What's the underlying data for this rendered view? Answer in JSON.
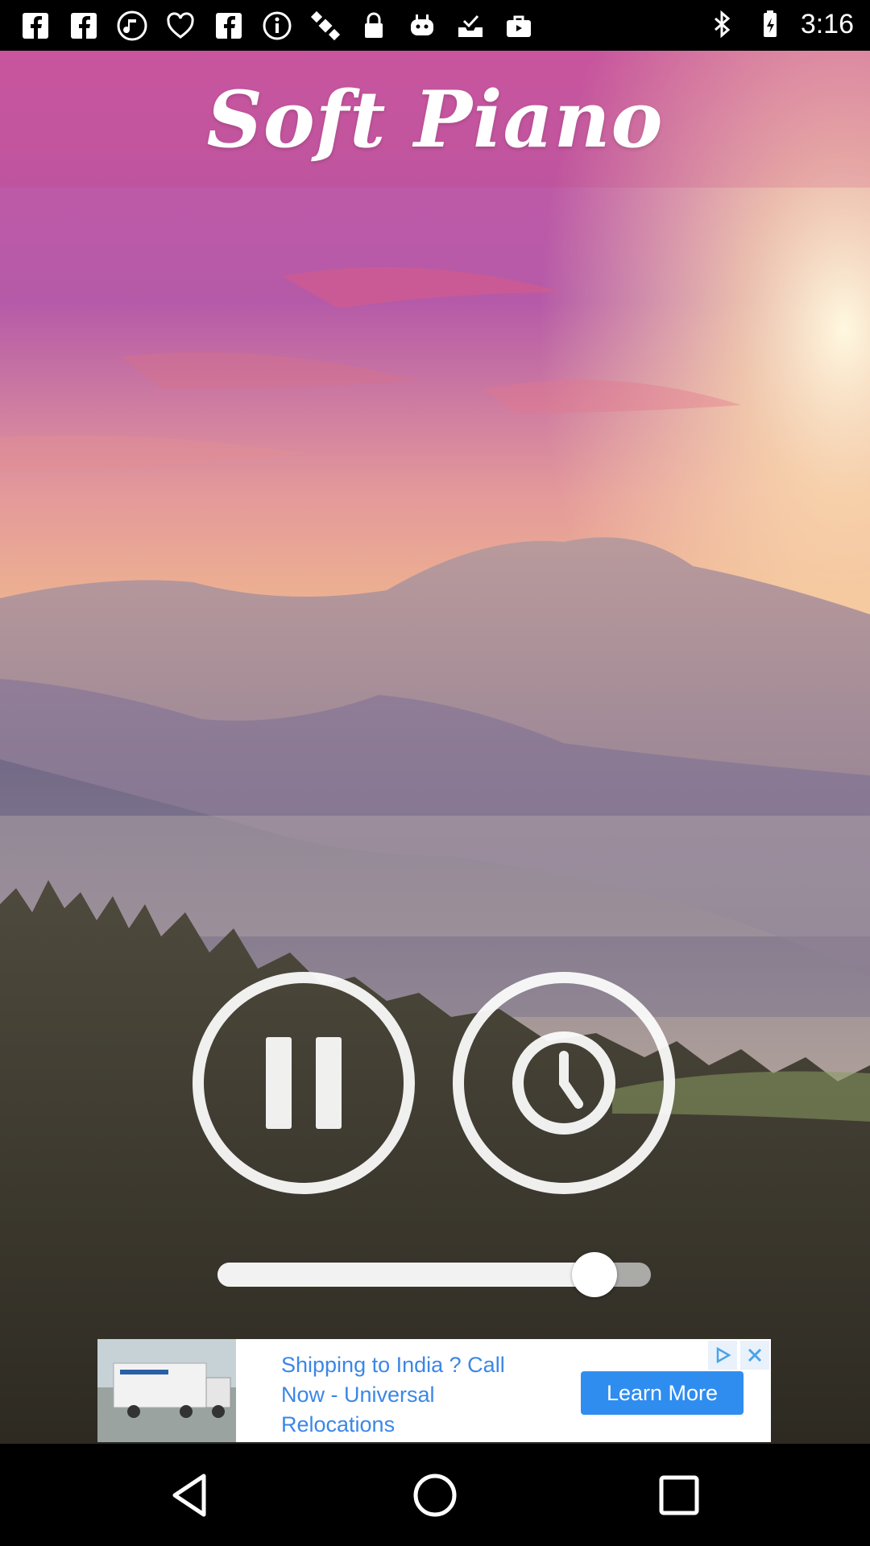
{
  "status_bar": {
    "time": "3:16",
    "left_icons": [
      "facebook-icon",
      "facebook-icon",
      "music-note-icon",
      "iheartradio-icon",
      "facebook-icon",
      "info-icon",
      "satellite-icon",
      "lock-icon",
      "robot-icon",
      "tray-check-icon",
      "briefcase-icon"
    ],
    "right_icons": [
      "bluetooth-icon",
      "battery-charging-icon"
    ]
  },
  "app": {
    "title": "Soft Piano"
  },
  "controls": {
    "pause_icon": "pause-icon",
    "timer_icon": "clock-icon"
  },
  "volume": {
    "level": 0.87
  },
  "ad": {
    "text": "Shipping to India ? Call Now - Universal Relocations",
    "button_label": "Learn More"
  },
  "colors": {
    "ad_text": "#3b87e6",
    "ad_button": "#2f8df0"
  }
}
